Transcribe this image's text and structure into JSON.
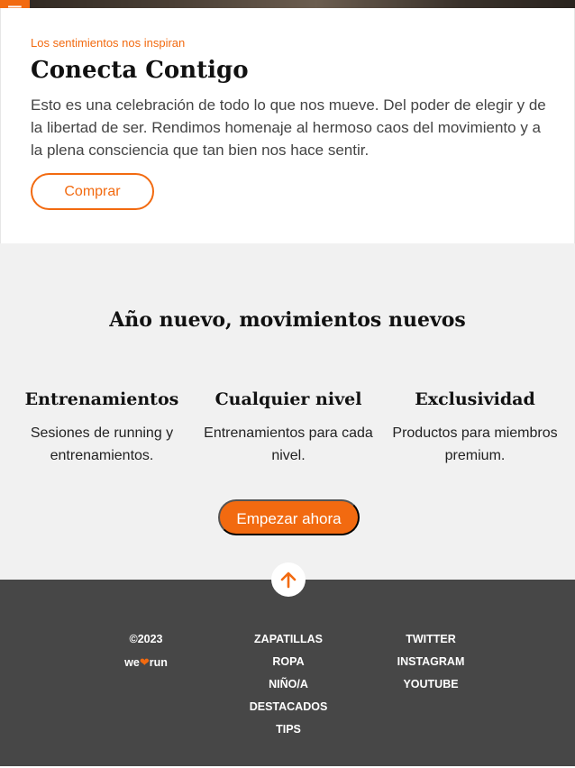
{
  "header": {
    "menu_icon": "hamburger-icon",
    "menu_glyph": "☰"
  },
  "hero": {
    "eyebrow": "Los sentimientos nos inspiran",
    "title": "Conecta Contigo",
    "text": "Esto es una celebración de todo lo que nos mueve. Del poder de elegir y de la libertad de ser. Rendimos homenaje al hermoso caos del movimiento y a la plena consciencia que tan bien nos hace sentir.",
    "cta": "Comprar"
  },
  "features": {
    "title": "Año nuevo, movimientos nuevos",
    "items": [
      {
        "title": "Entrenamientos",
        "text": "Sesiones de running y entrenamientos."
      },
      {
        "title": "Cualquier nivel",
        "text": "Entrenamientos para cada nivel."
      },
      {
        "title": "Exclusividad",
        "text": "Productos para miembros premium."
      }
    ],
    "cta": "Empezar ahora"
  },
  "footer": {
    "copyright": "©2023",
    "brand_prefix": "we",
    "brand_suffix": "run",
    "brand_icon": "heart-icon",
    "links": [
      "ZAPATILLAS",
      "ROPA",
      "NIÑO/A",
      "DESTACADOS",
      "TIPS"
    ],
    "social": [
      "TWITTER",
      "INSTAGRAM",
      "YOUTUBE"
    ]
  },
  "colors": {
    "accent": "#f26a10",
    "footer_bg": "#474747",
    "section_bg": "#f1f1f1"
  }
}
